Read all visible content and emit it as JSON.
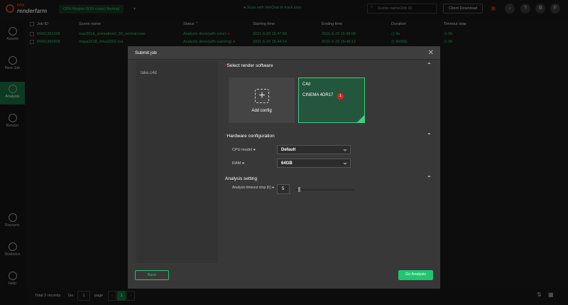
{
  "app": {
    "logo_top": "FOX",
    "logo_bottom": "renderfarm",
    "region": "CPU Region 0(16 cores)  Normal",
    "wechat": "Scan with WeChat to track jobs",
    "search_placeholder": "Scene name/Job ID",
    "client_download": "Client Download",
    "avatar_letter": "F"
  },
  "sidebar": {
    "items": [
      {
        "label": "Assets",
        "num": "1"
      },
      {
        "label": "New Job",
        "num": "2"
      },
      {
        "label": "Analysis",
        "num": "3"
      },
      {
        "label": "Render",
        "num": "4"
      },
      {
        "label": "Raysync"
      },
      {
        "label": "Statistics"
      },
      {
        "label": "Help"
      }
    ]
  },
  "table": {
    "headers": [
      "Job ID",
      "Scene name",
      "Status",
      "Starting time",
      "Ending time",
      "Duration",
      "Timeout stop"
    ],
    "rows": [
      [
        "6W61391355",
        "max2014_animation0_30_normal.max",
        "Analysis done(with error)",
        "2021-6-29 15:47:58",
        "2021-6-29 15:48:08",
        "9s",
        "5h"
      ],
      [
        "6W61390905",
        "maya2018_mtoa3202.ma",
        "Analysis done(with warning)",
        "2021-6-29 15:44:14",
        "2021-6-29 15:48:12",
        "5m58s",
        "5h"
      ]
    ]
  },
  "pagination": {
    "total": "Total 2 records",
    "go": "Go",
    "page_input": "1",
    "page": "page",
    "current": "1"
  },
  "modal": {
    "title": "Submit job",
    "file": "take.c4d",
    "software_title": "Select render software",
    "add_config": "Add config",
    "card_title": "C4d",
    "card_version": "CINEMA 4DR17",
    "card_badge": "1",
    "hardware_title": "Hardware configuration",
    "cpu_label": "CPU model",
    "cpu_value": "Default",
    "ram_label": "RAM",
    "ram_value": "64GB",
    "analysis_title": "Analysis setting",
    "timeout_label": "Analysis timeout stop (h)",
    "timeout_value": "5",
    "timeout_slider_fraction": 0.05,
    "back": "Back",
    "go_analysis": "Go Analysis"
  },
  "colors": {
    "accent": "#1ec66f",
    "error": "#e02020",
    "warning": "#e07a10"
  }
}
